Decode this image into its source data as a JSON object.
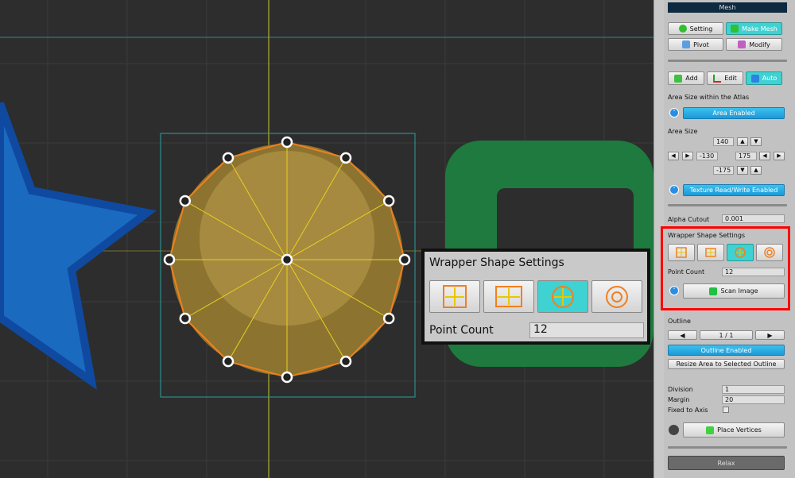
{
  "panel": {
    "title": "Mesh",
    "tabs": [
      {
        "label": "Setting",
        "icon": "info-icon"
      },
      {
        "label": "Make Mesh",
        "icon": "mesh-icon",
        "active": true
      },
      {
        "label": "Pivot",
        "icon": "pivot-icon"
      },
      {
        "label": "Modify",
        "icon": "modify-icon"
      }
    ],
    "modes": [
      {
        "label": "Add",
        "icon": "add-vertex-icon"
      },
      {
        "label": "Edit",
        "icon": "edit-axis-icon"
      },
      {
        "label": "Auto",
        "icon": "auto-icon",
        "active": true
      }
    ],
    "area_atlas_label": "Area Size within the Atlas",
    "area_enabled": "Area Enabled",
    "area_size_label": "Area Size",
    "area_top": "140",
    "area_left": "-130",
    "area_right": "175",
    "area_bottom": "-175",
    "texture_rw": "Texture Read/Write Enabled",
    "alpha_cutout_label": "Alpha Cutout",
    "alpha_cutout": "0.001",
    "wrapper_label": "Wrapper Shape Settings",
    "point_count_label": "Point Count",
    "point_count": "12",
    "scan_image": "Scan Image",
    "outline_label": "Outline",
    "outline_page": "1 / 1",
    "outline_enabled": "Outline Enabled",
    "resize_area": "Resize Area to Selected Outline",
    "division_label": "Division",
    "division": "1",
    "margin_label": "Margin",
    "margin": "20",
    "fixed_axis_label": "Fixed to Axis",
    "fixed_axis": false,
    "place_vertices": "Place Vertices",
    "relax": "Relax"
  },
  "callout": {
    "title": "Wrapper Shape Settings",
    "point_count_label": "Point Count",
    "point_count": "12",
    "selected_shape": 3
  },
  "colors": {
    "accent": "#3fd2d2",
    "highlight": "#ff0000",
    "button_blue": "#1a9ad8"
  }
}
